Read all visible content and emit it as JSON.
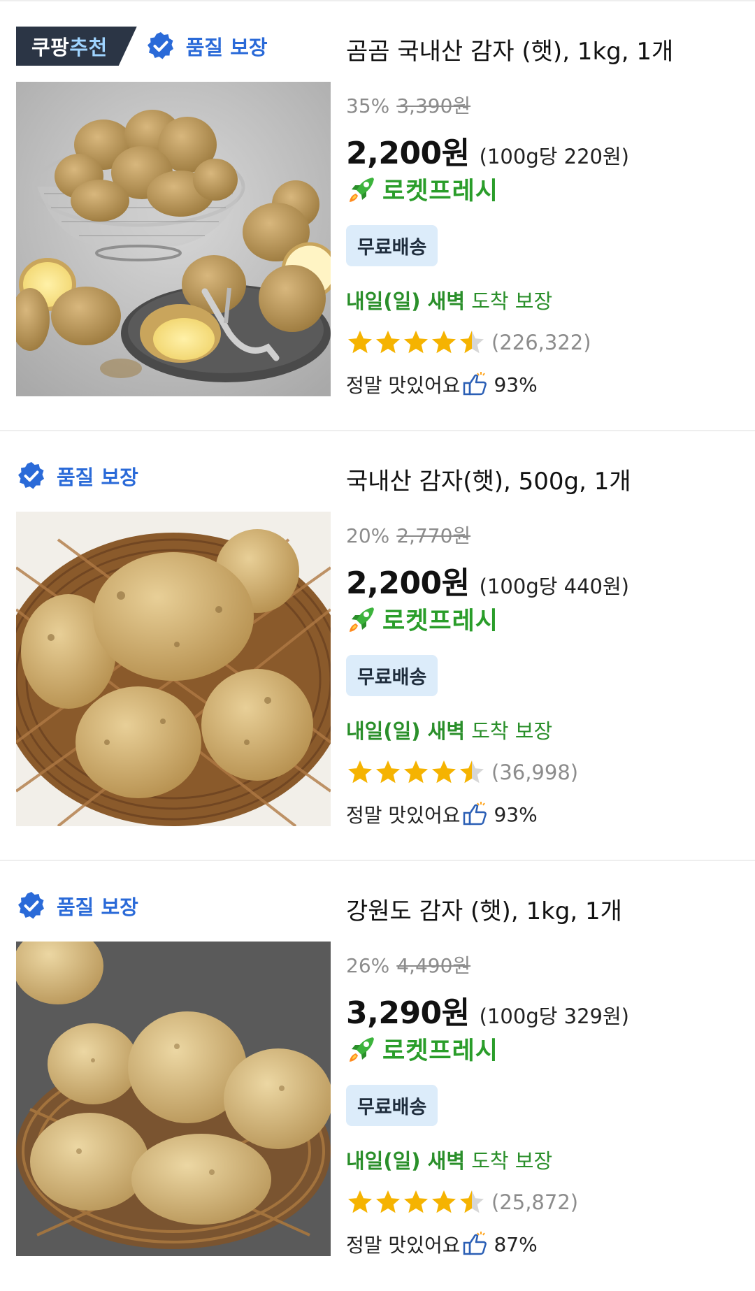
{
  "products": [
    {
      "show_recommend": true,
      "recommend_badge": [
        "쿠팡",
        "추천"
      ],
      "quality_label": "품질 보장",
      "title": "곰곰 국내산 감자 (햇), 1kg, 1개",
      "discount_pct": "35%",
      "original_price": "3,390원",
      "price": "2,200원",
      "unit_price": "(100g당 220원)",
      "rocket_label": "로켓프레시",
      "free_shipping": "무료배송",
      "delivery_bold": "내일(일) 새벽",
      "delivery_rest": " 도착 보장",
      "rating": 4.5,
      "review_count": "(226,322)",
      "taste_label": "정말 맛있어요",
      "taste_pct": "93%"
    },
    {
      "show_recommend": false,
      "quality_label": "품질 보장",
      "title": "국내산 감자(햇), 500g, 1개",
      "discount_pct": "20%",
      "original_price": "2,770원",
      "price": "2,200원",
      "unit_price": "(100g당 440원)",
      "rocket_label": "로켓프레시",
      "free_shipping": "무료배송",
      "delivery_bold": "내일(일) 새벽",
      "delivery_rest": " 도착 보장",
      "rating": 4.5,
      "review_count": "(36,998)",
      "taste_label": "정말 맛있어요",
      "taste_pct": "93%"
    },
    {
      "show_recommend": false,
      "quality_label": "품질 보장",
      "title": "강원도 감자 (햇), 1kg, 1개",
      "discount_pct": "26%",
      "original_price": "4,490원",
      "price": "3,290원",
      "unit_price": "(100g당 329원)",
      "rocket_label": "로켓프레시",
      "free_shipping": "무료배송",
      "delivery_bold": "내일(일) 새벽",
      "delivery_rest": " 도착 보장",
      "rating": 4.5,
      "review_count": "(25,872)",
      "taste_label": "정말 맛있어요",
      "taste_pct": "87%"
    }
  ],
  "colors": {
    "quality_blue": "#2a6ad8",
    "rocket_green": "#2a9d2a",
    "delivery_green": "#2a8f2a",
    "star_yellow": "#f5b301",
    "free_bg": "#dcecfa",
    "badge_dark": "#2b3545"
  },
  "icons": {
    "quality": "verified-check-icon",
    "rocket": "rocket-icon",
    "star": "star-icon",
    "thumbs_up": "thumbs-up-icon"
  }
}
